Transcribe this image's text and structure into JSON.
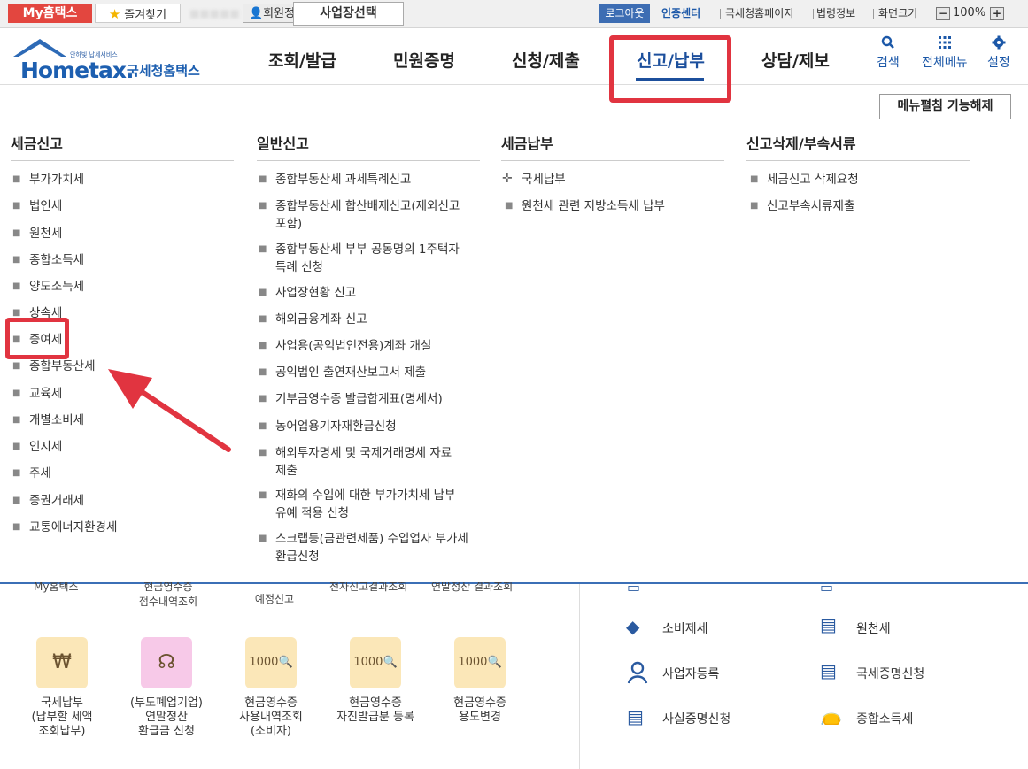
{
  "topbar": {
    "myhome": "My홈택스",
    "favorites": "즐겨찾기",
    "member_info": "회원정보",
    "business_select": "사업장선택",
    "logout": "로그아웃",
    "cert_center": "인증센터",
    "nts_home": "국세청홈페이지",
    "law_info": "법령정보",
    "zoom_label": "화면크기",
    "zoom_value": "100%",
    "zoom_minus": "−",
    "zoom_plus": "+"
  },
  "logo": {
    "sub": "안하빛 납세서비스",
    "brand": "Hometax.",
    "kr": "국세청홈택스"
  },
  "gnb": [
    "조회/발급",
    "민원증명",
    "신청/제출",
    "신고/납부",
    "상담/제보"
  ],
  "utility": {
    "search": "검색",
    "all_menu": "전체메뉴",
    "settings": "설정"
  },
  "panel": {
    "collapse_button": "메뉴펼침 기능해제",
    "col1": {
      "title": "세금신고",
      "items": [
        "부가가치세",
        "법인세",
        "원천세",
        "종합소득세",
        "양도소득세",
        "상속세",
        "증여세",
        "종합부동산세",
        "교육세",
        "개별소비세",
        "인지세",
        "주세",
        "증권거래세",
        "교통에너지환경세"
      ]
    },
    "col2": {
      "title": "일반신고",
      "items": [
        [
          "종합부동산세 과세특례신고"
        ],
        [
          "종합부동산세 합산배제신고(제외신고",
          "포함)"
        ],
        [
          "종합부동산세 부부 공동명의 1주택자",
          "특례 신청"
        ],
        [
          "사업장현황 신고"
        ],
        [
          "해외금융계좌 신고"
        ],
        [
          "사업용(공익법인전용)계좌 개설"
        ],
        [
          "공익법인 출연재산보고서 제출"
        ],
        [
          "기부금영수증 발급합계표(명세서)"
        ],
        [
          "농어업용기자재환급신청"
        ],
        [
          "해외투자명세 및 국제거래명세 자료",
          "제출"
        ],
        [
          "재화의 수입에 대한 부가가치세 납부",
          "유예 적용 신청"
        ],
        [
          "스크랩등(금관련제품) 수입업자 부가세",
          "환급신청"
        ]
      ]
    },
    "col3": {
      "title": "세금납부",
      "items": [
        "국세납부",
        "원천세 관련 지방소득세 납부"
      ]
    },
    "col4": {
      "title": "신고삭제/부속서류",
      "items": [
        "세금신고 삭제요청",
        "신고부속서류제출"
      ]
    }
  },
  "lower": {
    "ghost": [
      "My홈택스",
      "현금영수증",
      "전자신고결과조회",
      "연말정산 결과조회",
      "접수내역조회",
      "예정신고"
    ],
    "quick": [
      [
        "국세납부",
        "(납부할 세액",
        "조회납부)"
      ],
      [
        "(부도폐업기업)",
        "연말정산",
        "환급금 신청"
      ],
      [
        "현금영수증",
        "사용내역조회",
        "(소비자)"
      ],
      [
        "현금영수증",
        "자진발급분 등록"
      ],
      [
        "현금영수증",
        "용도변경"
      ]
    ],
    "right_links": [
      "소비제세",
      "원천세",
      "사업자등록",
      "국세증명신청",
      "사실증명신청",
      "종합소득세"
    ]
  },
  "colors": {
    "accent": "#1c4f9c",
    "highlight": "#e13440",
    "brand_red": "#e3463f"
  }
}
